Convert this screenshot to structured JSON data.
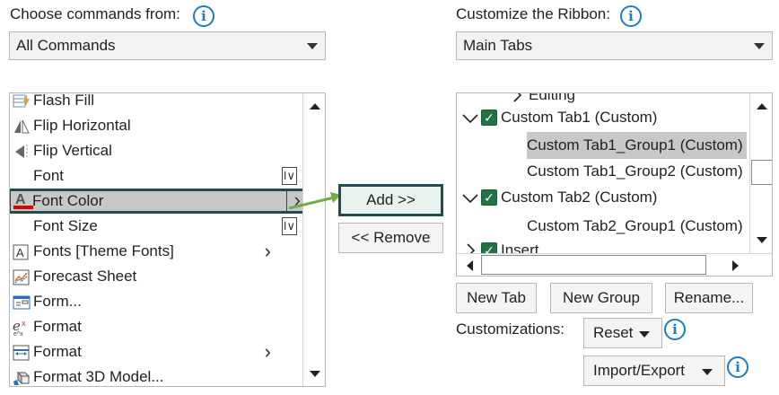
{
  "left": {
    "label": "Choose commands from:",
    "label_access_key_index": 7,
    "dropdown_value": "All Commands",
    "commands": [
      {
        "label": "Flash Fill",
        "icon": "flash-fill-icon",
        "submenu": ""
      },
      {
        "label": "Flip Horizontal",
        "icon": "flip-horizontal-icon",
        "submenu": ""
      },
      {
        "label": "Flip Vertical",
        "icon": "flip-vertical-icon",
        "submenu": ""
      },
      {
        "label": "Font",
        "icon": "",
        "submenu": "I∨"
      },
      {
        "label": "Font Color",
        "icon": "font-color-icon",
        "submenu": "›"
      },
      {
        "label": "Font Size",
        "icon": "",
        "submenu": "I∨"
      },
      {
        "label": "Fonts [Theme Fonts]",
        "icon": "theme-fonts-icon",
        "submenu": "›"
      },
      {
        "label": "Forecast Sheet",
        "icon": "forecast-sheet-icon",
        "submenu": ""
      },
      {
        "label": "Form...",
        "icon": "form-icon",
        "submenu": ""
      },
      {
        "label": "Format",
        "icon": "format-icon",
        "submenu": ""
      },
      {
        "label": "Format",
        "icon": "format-cells-icon",
        "submenu": "›"
      },
      {
        "label": "Format 3D Model...",
        "icon": "format-3d-model-icon",
        "submenu": ""
      }
    ],
    "selected_index": 4
  },
  "middle": {
    "add_label": "Add >>",
    "remove_label": "<< Remove"
  },
  "right": {
    "label": "Customize the Ribbon:",
    "dropdown_value": "Main Tabs",
    "tree": [
      {
        "label": "Editing",
        "level": 2,
        "checked": false,
        "expander": "right",
        "partial": true
      },
      {
        "label": "Custom Tab1 (Custom)",
        "level": 0,
        "checked": true,
        "expander": "down"
      },
      {
        "label": "Custom Tab1_Group1 (Custom)",
        "level": 1,
        "checked": false,
        "expander": "",
        "selected": true
      },
      {
        "label": "Custom Tab1_Group2 (Custom)",
        "level": 1,
        "checked": false,
        "expander": ""
      },
      {
        "label": "Custom Tab2 (Custom)",
        "level": 0,
        "checked": true,
        "expander": "down"
      },
      {
        "label": "Custom Tab2_Group1 (Custom)",
        "level": 1,
        "checked": false,
        "expander": ""
      },
      {
        "label": "Insert",
        "level": 0,
        "checked": true,
        "expander": "right",
        "partial": true
      }
    ],
    "new_tab_label": "New Tab",
    "new_group_label": "New Group",
    "rename_label": "Rename...",
    "customizations_label": "Customizations:",
    "reset_label": "Reset",
    "import_export_label": "Import/Export"
  },
  "colors": {
    "accent_green": "#217346",
    "highlight_border": "#1f4e4f",
    "add_button_bg": "#e8f3ef",
    "arrow_green": "#70ad47",
    "info_blue": "#1c7cc4",
    "selected_row_bg": "#c8c8c8",
    "font_color_red": "#e00000"
  }
}
